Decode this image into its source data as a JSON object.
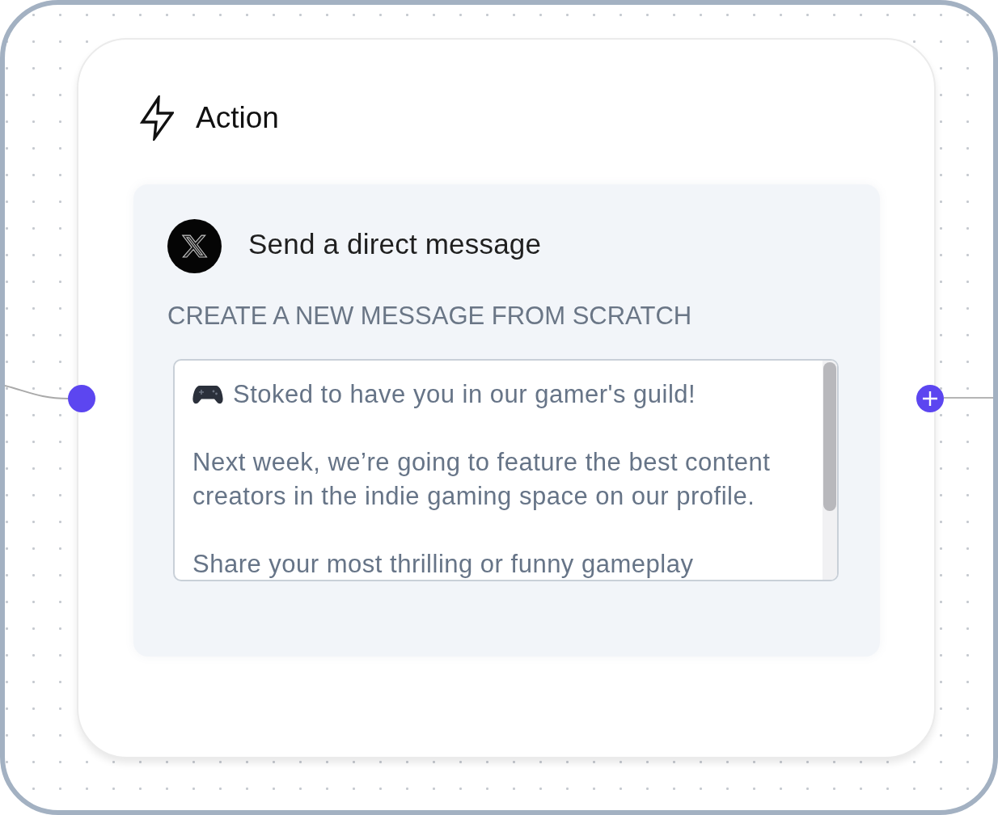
{
  "node": {
    "title": "Action"
  },
  "step": {
    "title": "Send a direct message",
    "section_label": "CREATE A NEW MESSAGE FROM SCRATCH",
    "message_field": {
      "value": "Stoked to have you in our gamer's guild!\n\nNext week, we’re going to feature the best content creators in the indie gaming space on our profile.\n\nShare your most thrilling or funny gameplay"
    }
  }
}
